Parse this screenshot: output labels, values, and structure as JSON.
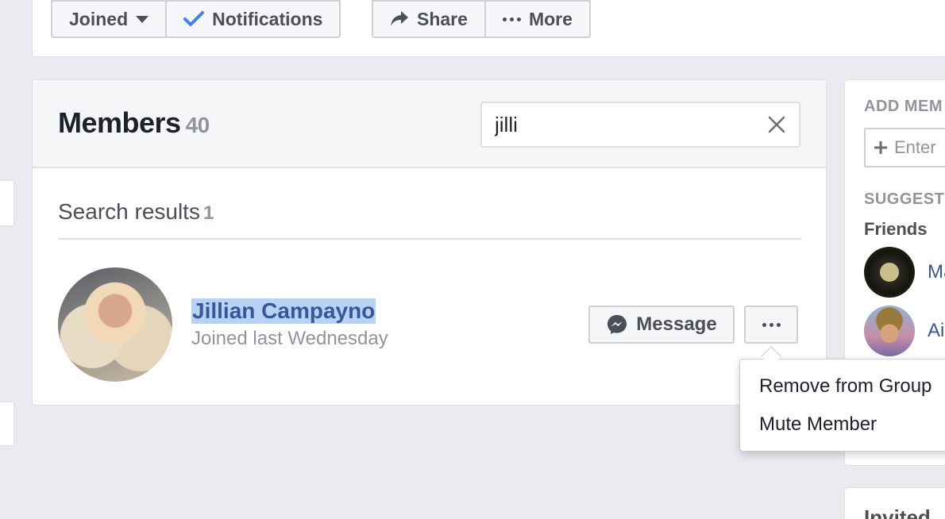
{
  "group_actions": {
    "joined_label": "Joined",
    "notifications_label": "Notifications",
    "share_label": "Share",
    "more_label": "More"
  },
  "members": {
    "title": "Members",
    "count": "40",
    "search": {
      "value": "jilli"
    },
    "results_label": "Search results",
    "results_count": "1",
    "result": {
      "name": "Jillian Campayno",
      "subtitle": "Joined last Wednesday",
      "message_label": "Message"
    }
  },
  "member_menu": {
    "items": [
      {
        "label": "Remove from Group"
      },
      {
        "label": "Mute Member"
      }
    ]
  },
  "sidebar": {
    "add_members_heading": "ADD MEM",
    "add_members_placeholder": "Enter",
    "suggested_heading": "SUGGEST",
    "friends_label": "Friends",
    "suggestions": [
      {
        "name": "Ma"
      },
      {
        "name": "Ai"
      }
    ],
    "invited_heading": "Invited"
  },
  "colors": {
    "link_blue": "#365899",
    "selection_highlight": "#b8d2f5",
    "check_blue": "#4080ff",
    "page_bg": "#e9ebee"
  }
}
